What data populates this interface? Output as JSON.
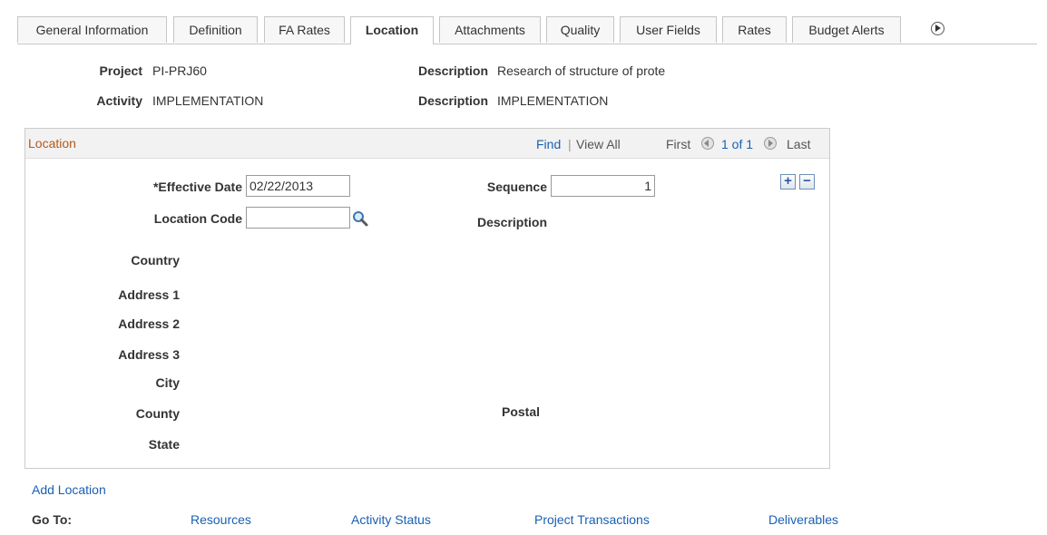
{
  "tabs": [
    {
      "label": "General Information",
      "active": false
    },
    {
      "label": "Definition",
      "active": false
    },
    {
      "label": "FA Rates",
      "active": false
    },
    {
      "label": "Location",
      "active": true
    },
    {
      "label": "Attachments",
      "active": false
    },
    {
      "label": "Quality",
      "active": false
    },
    {
      "label": "User Fields",
      "active": false
    },
    {
      "label": "Rates",
      "active": false
    },
    {
      "label": "Budget Alerts",
      "active": false
    }
  ],
  "header": {
    "project_label": "Project",
    "project_value": "PI-PRJ60",
    "activity_label": "Activity",
    "activity_value": "IMPLEMENTATION",
    "description1_label": "Description",
    "description1_value": "Research of structure of prote",
    "description2_label": "Description",
    "description2_value": "IMPLEMENTATION"
  },
  "location_group": {
    "title": "Location",
    "find": "Find",
    "separator": "|",
    "view_all": "View All",
    "first": "First",
    "page_status": "1 of 1",
    "last": "Last",
    "effective_date_label": "*Effective Date",
    "effective_date_value": "02/22/2013",
    "sequence_label": "Sequence",
    "sequence_value": "1",
    "add_row": "+",
    "delete_row": "−",
    "location_code_label": "Location Code",
    "location_code_value": "",
    "description_label": "Description",
    "country_label": "Country",
    "address1_label": "Address 1",
    "address2_label": "Address 2",
    "address3_label": "Address 3",
    "city_label": "City",
    "county_label": "County",
    "postal_label": "Postal",
    "state_label": "State"
  },
  "footer": {
    "add_location": "Add Location",
    "goto_label": "Go To:",
    "links": [
      "Resources",
      "Activity Status",
      "Project Transactions",
      "Deliverables"
    ]
  },
  "colors": {
    "link": "#1a5fb4",
    "group_title": "#b05a1a",
    "tab_border": "#c5c5c5"
  },
  "icons": [
    "next-tab-arrow-icon",
    "lookup-magnifier-icon",
    "previous-row-icon",
    "next-row-icon"
  ]
}
